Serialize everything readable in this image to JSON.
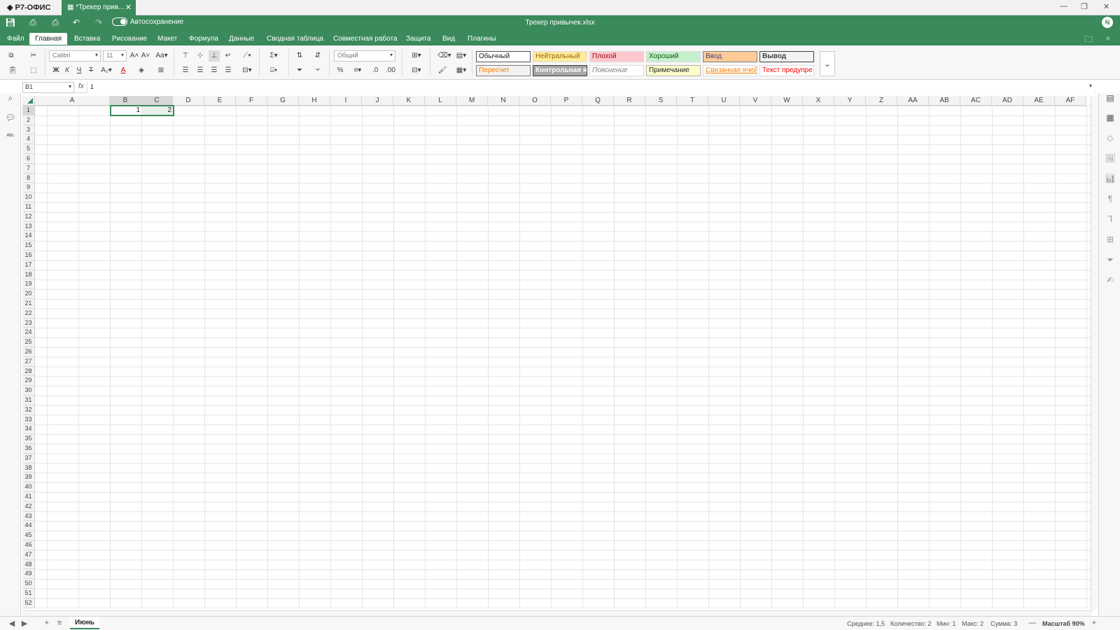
{
  "app": {
    "logo": "Р7-ОФИС",
    "tab_title": "*Трекер прив...",
    "doc_title": "Трекер привычек.xlsx",
    "autosave_label": "Автосохранение",
    "user_initial": "N",
    "accent_color": "#3a8a5c"
  },
  "menu": {
    "tabs": [
      "Файл",
      "Главная",
      "Вставка",
      "Рисование",
      "Макет",
      "Формула",
      "Данные",
      "Сводная таблица",
      "Совместная работа",
      "Защита",
      "Вид",
      "Плагины"
    ],
    "active": "Главная"
  },
  "ribbon": {
    "font_name": "Calibri",
    "font_size": "11",
    "number_format": "Общий",
    "styles_row1": [
      "Обычный",
      "Нейтральный",
      "Плохой",
      "Хороший",
      "Ввод",
      "Вывод"
    ],
    "styles_row2": [
      "Пересчет",
      "Контрольная я",
      "Пояснение",
      "Примечание",
      "Связанная ячей",
      "Текст предупре"
    ]
  },
  "formula_bar": {
    "name_box": "B1",
    "fx": "fx",
    "value": "1"
  },
  "sheet": {
    "columns": [
      "A",
      "B",
      "C",
      "D",
      "E",
      "F",
      "G",
      "H",
      "I",
      "J",
      "K",
      "L",
      "M",
      "N",
      "O",
      "P",
      "Q",
      "R",
      "S",
      "T",
      "U",
      "V",
      "W",
      "X",
      "Y",
      "Z",
      "AA",
      "AB",
      "AC",
      "AD",
      "AE",
      "AF"
    ],
    "rows": [
      "1",
      "2",
      "3",
      "4",
      "5",
      "6",
      "7",
      "8",
      "9",
      "10",
      "11",
      "12",
      "13",
      "14",
      "15",
      "16",
      "17",
      "18",
      "19",
      "20",
      "21",
      "22",
      "23",
      "24",
      "25",
      "26",
      "27",
      "28",
      "29",
      "30",
      "31",
      "32",
      "33",
      "34",
      "35",
      "36",
      "37",
      "38",
      "39",
      "40",
      "41",
      "42",
      "43",
      "44",
      "45",
      "46",
      "47",
      "48",
      "49",
      "50",
      "51",
      "52"
    ],
    "cells": {
      "B1": "1",
      "C1": "2"
    }
  },
  "status": {
    "sheet_name": "Июнь",
    "average": "Среднее: 1,5",
    "count": "Количество: 2",
    "min": "Мин: 1",
    "max": "Макс: 2",
    "sum": "Сумма: 3",
    "zoom": "Масштаб 90%"
  }
}
